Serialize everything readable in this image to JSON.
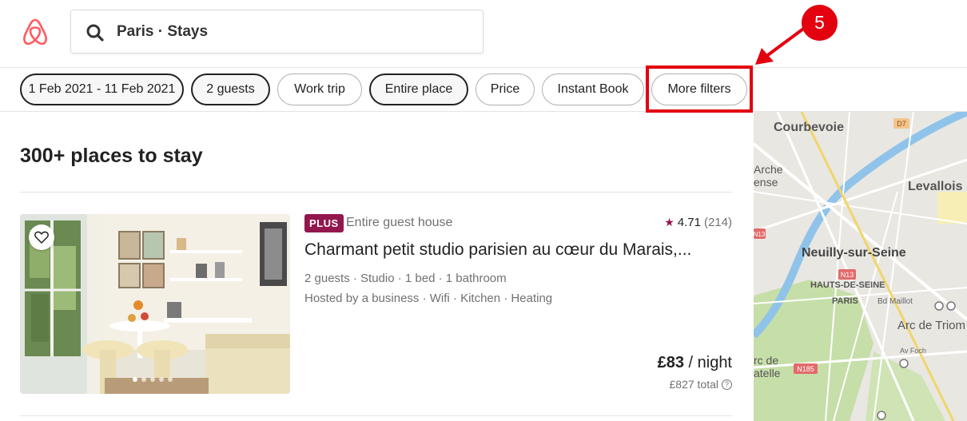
{
  "search": {
    "query": "Paris · Stays"
  },
  "filters": [
    {
      "label": "1 Feb 2021 - 11 Feb 2021",
      "active": true
    },
    {
      "label": "2 guests",
      "active": true
    },
    {
      "label": "Work trip",
      "active": false
    },
    {
      "label": "Entire place",
      "active": true
    },
    {
      "label": "Price",
      "active": false
    },
    {
      "label": "Instant Book",
      "active": false
    },
    {
      "label": "More filters",
      "active": false
    }
  ],
  "annotation": {
    "step": "5",
    "color": "#e3000f"
  },
  "results": {
    "title": "300+ places to stay"
  },
  "listing": {
    "badge": "PLUS",
    "type": "Entire guest house",
    "rating": "4.71",
    "reviews": "(214)",
    "title": "Charmant petit studio parisien au cœur du Marais,...",
    "details": "2 guests · Studio · 1 bed · 1 bathroom",
    "amenities": "Hosted by a business · Wifi · Kitchen · Heating",
    "price": "£83",
    "price_unit": " / night",
    "total": "£827 total",
    "photo_count": 5,
    "photo_index": 1
  },
  "map": {
    "labels": [
      "Courbevoie",
      "Arche",
      "ense",
      "Levallois",
      "Neuilly-sur-Seine",
      "HAUTS-DE-SEINE",
      "PARIS",
      "Bd Maillot",
      "Arc de Triom",
      "rc de",
      "atelle",
      "Av Foch"
    ],
    "roads": [
      "D7",
      "N13",
      "N13",
      "N185"
    ]
  },
  "colors": {
    "accent": "#92174d",
    "brand": "#ff5a5f",
    "annotation": "#e3000f"
  }
}
